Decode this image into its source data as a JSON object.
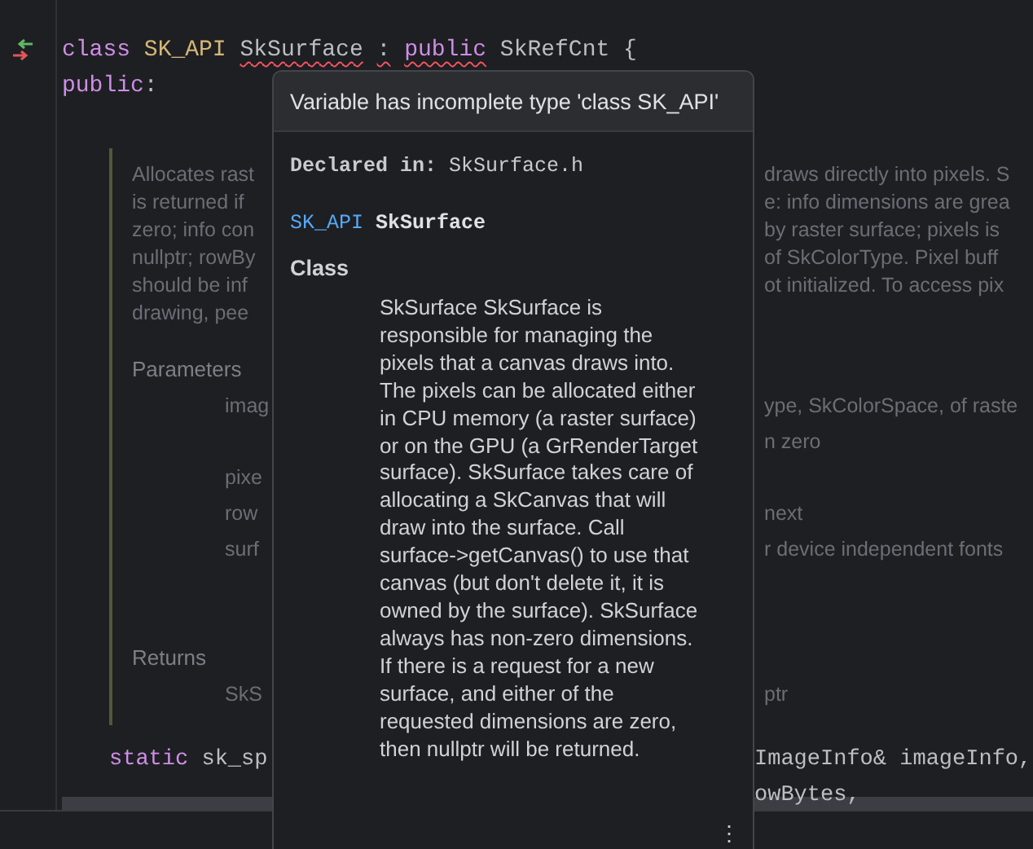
{
  "code_top": [
    {
      "tokens": [
        {
          "text": "class",
          "kind": "keyword",
          "error": false
        },
        {
          "text": "SK_API",
          "kind": "macro",
          "error": false
        },
        {
          "text": "SkSurface",
          "kind": "plain",
          "error": true
        },
        {
          "text": ":",
          "kind": "plain",
          "error": true
        },
        {
          "text": "public",
          "kind": "keyword",
          "error": true
        },
        {
          "text": "SkRefCnt {",
          "kind": "plain",
          "error": false
        }
      ]
    },
    {
      "tokens": [
        {
          "text": "public",
          "kind": "keyword",
          "error": false
        },
        {
          "text": ":",
          "kind": "plain",
          "error": false,
          "joined": true
        }
      ]
    }
  ],
  "doc": {
    "description": [
      {
        "left": "Allocates rast",
        "right": "draws directly into pixels. S"
      },
      {
        "left": "is returned if",
        "right": "e: info dimensions are grea"
      },
      {
        "left": "zero; info con",
        "right": "by raster surface; pixels is"
      },
      {
        "left": "nullptr; rowBy",
        "right": "of SkColorType. Pixel buff"
      },
      {
        "left": "should be inf",
        "right": "ot initialized. To access pix"
      },
      {
        "left": "drawing, pee"
      }
    ],
    "parameters_heading": "Parameters",
    "parameters": [
      {
        "left": "imag",
        "right": "ype, SkColorSpace, of raste"
      },
      {
        "right": "n zero"
      },
      {
        "left": "pixe"
      },
      {
        "left": "row",
        "right": "next"
      },
      {
        "left": "surf",
        "right": "r device independent fonts"
      }
    ],
    "returns_heading": "Returns",
    "returns": [
      {
        "left": "SkS",
        "right": "ptr"
      }
    ]
  },
  "code_bottom": [
    {
      "tokens": [
        {
          "text": "static",
          "kind": "keyword",
          "error": false
        },
        {
          "text": "sk_sp",
          "kind": "plain",
          "error": false
        }
      ],
      "right": "ImageInfo& imageInfo,"
    },
    {
      "right": "owBytes,"
    }
  ],
  "popup": {
    "message": "Variable has incomplete type 'class SK_API'",
    "declared": "**Declared in:** SkSurface.h",
    "signature": [
      {
        "text": "SK_API",
        "kind": "macro"
      },
      {
        "text": "SkSurface",
        "kind": "name"
      }
    ],
    "kind_label": "Class",
    "description": "SkSurface SkSurface is responsible for managing the pixels that a canvas draws into. The pixels can be allocated either in CPU memory (a raster surface) or on the GPU (a GrRenderTarget surface). SkSurface takes care of allocating a SkCanvas that will draw into the surface. Call surface->getCanvas() to use that canvas (but don't delete it, it is owned by the surface). SkSurface always has non-zero dimensions. If there is a request for a new surface, and either of the requested dimensions are zero, then nullptr will be returned.",
    "more": "⋮"
  }
}
